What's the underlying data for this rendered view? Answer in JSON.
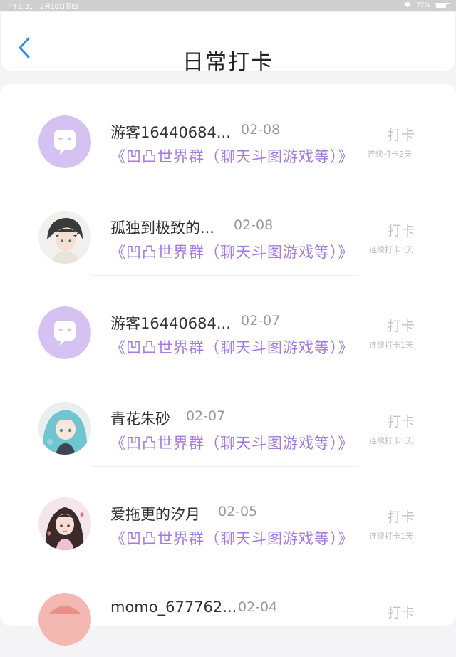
{
  "status_bar": {
    "time": "下午1:31",
    "date": "2月10日周四",
    "battery": "77%"
  },
  "header": {
    "title": "日常打卡"
  },
  "entries": [
    {
      "name": "游客16440684...",
      "date": "02-08",
      "group": "《凹凸世界群（聊天斗图游戏等）》",
      "action": "打卡",
      "streak": "连续打卡2天",
      "avatar": "ghost-icon"
    },
    {
      "name": "孤独到极致的...",
      "date": "02-08",
      "group": "《凹凸世界群（聊天斗图游戏等）》",
      "action": "打卡",
      "streak": "连续打卡1天",
      "avatar": "anime-boy-avatar"
    },
    {
      "name": "游客16440684...",
      "date": "02-07",
      "group": "《凹凸世界群（聊天斗图游戏等）》",
      "action": "打卡",
      "streak": "连续打卡1天",
      "avatar": "ghost-icon"
    },
    {
      "name": "青花朱砂",
      "date": "02-07",
      "group": "《凹凸世界群（聊天斗图游戏等）》",
      "action": "打卡",
      "streak": "连续打卡1天",
      "avatar": "anime-girl-teal-avatar"
    },
    {
      "name": "爱拖更的汐月",
      "date": "02-05",
      "group": "《凹凸世界群（聊天斗图游戏等）》",
      "action": "打卡",
      "streak": "连续打卡1天",
      "avatar": "anime-girl-dark-avatar"
    },
    {
      "name": "momo_677762...",
      "date": "02-04",
      "group": "",
      "action": "打卡",
      "streak": "",
      "avatar": "pink-avatar"
    }
  ],
  "colors": {
    "accent": "#2f8ff0",
    "group_text": "#a57be0",
    "ghost_bg": "#d6c1f3"
  }
}
